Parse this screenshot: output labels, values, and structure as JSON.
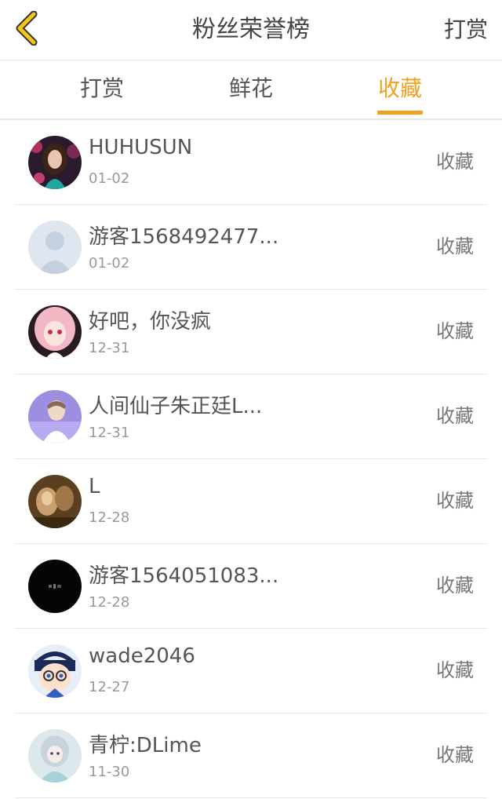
{
  "header": {
    "title": "粉丝荣誉榜",
    "action_label": "打赏"
  },
  "tabs": [
    {
      "label": "打赏",
      "active": false
    },
    {
      "label": "鲜花",
      "active": false
    },
    {
      "label": "收藏",
      "active": true
    }
  ],
  "colors": {
    "accent": "#f2a020",
    "text": "#555555",
    "muted": "#999999"
  },
  "list": [
    {
      "name": "HUHUSUN",
      "date": "01-02",
      "type": "收藏"
    },
    {
      "name": "游客1568492477...",
      "date": "01-02",
      "type": "收藏"
    },
    {
      "name": "好吧，你没疯",
      "date": "12-31",
      "type": "收藏"
    },
    {
      "name": "人间仙子朱正廷L...",
      "date": "12-31",
      "type": "收藏"
    },
    {
      "name": "L",
      "date": "12-28",
      "type": "收藏"
    },
    {
      "name": "游客1564051083...",
      "date": "12-28",
      "type": "收藏"
    },
    {
      "name": "wade2046",
      "date": "12-27",
      "type": "收藏"
    },
    {
      "name": "青柠:DLime",
      "date": "11-30",
      "type": "收藏"
    }
  ]
}
